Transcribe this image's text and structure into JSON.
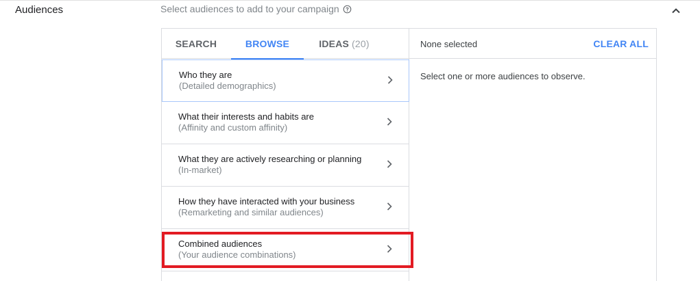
{
  "section": {
    "title": "Audiences",
    "subtitle": "Select audiences to add to your campaign",
    "help_icon": "help-circle-icon",
    "collapse_icon": "chevron-up-icon"
  },
  "tabs": [
    {
      "label": "SEARCH",
      "count": ""
    },
    {
      "label": "BROWSE",
      "count": ""
    },
    {
      "label": "IDEAS",
      "count": "(20)"
    }
  ],
  "active_tab": "BROWSE",
  "browse_items": [
    {
      "title": "Who they are",
      "subtitle": "(Detailed demographics)"
    },
    {
      "title": "What their interests and habits are",
      "subtitle": "(Affinity and custom affinity)"
    },
    {
      "title": "What they are actively researching or planning",
      "subtitle": "(In-market)"
    },
    {
      "title": "How they have interacted with your business",
      "subtitle": "(Remarketing and similar audiences)"
    },
    {
      "title": "Combined audiences",
      "subtitle": "(Your audience combinations)"
    }
  ],
  "selection": {
    "status": "None selected",
    "clear_label": "CLEAR ALL",
    "hint": "Select one or more audiences to observe."
  },
  "colors": {
    "accent": "#4285f4",
    "highlight": "#e21b23"
  }
}
